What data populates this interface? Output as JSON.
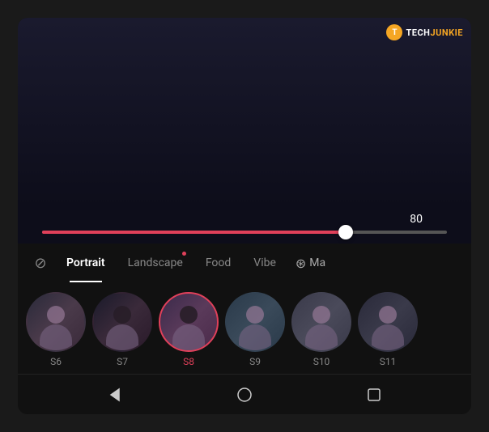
{
  "watermark": {
    "icon_label": "T",
    "tech": "TECH",
    "junkie": "JUNKIE"
  },
  "slider": {
    "value": "80",
    "fill_percent": 75
  },
  "tabs": {
    "no_filter_icon": "⊘",
    "items": [
      {
        "id": "portrait",
        "label": "Portrait",
        "active": true,
        "dot": false
      },
      {
        "id": "landscape",
        "label": "Landscape",
        "active": false,
        "dot": true
      },
      {
        "id": "food",
        "label": "Food",
        "active": false,
        "dot": false
      },
      {
        "id": "vibe",
        "label": "Vibe",
        "active": false,
        "dot": false
      }
    ],
    "more_label": "Ma",
    "more_icon": "⊛"
  },
  "presets": [
    {
      "id": "s6",
      "label": "S6",
      "selected": false
    },
    {
      "id": "s7",
      "label": "S7",
      "selected": false
    },
    {
      "id": "s8",
      "label": "S8",
      "selected": true
    },
    {
      "id": "s9",
      "label": "S9",
      "selected": false
    },
    {
      "id": "s10",
      "label": "S10",
      "selected": false
    },
    {
      "id": "s11",
      "label": "S11",
      "selected": false
    }
  ],
  "nav": {
    "back_label": "back",
    "home_label": "home",
    "recent_label": "recent"
  }
}
